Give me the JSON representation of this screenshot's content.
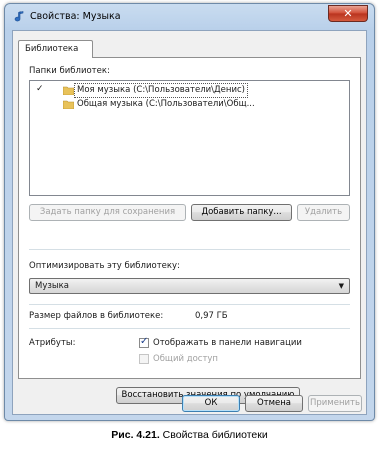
{
  "window": {
    "title": "Свойства: Музыка",
    "close_glyph": "✕"
  },
  "tab": {
    "label": "Библиотека"
  },
  "folders": {
    "label": "Папки библиотек:",
    "items": [
      {
        "check": "✓",
        "label": "Моя музыка (C:\\Пользователи\\Денис)"
      },
      {
        "check": "",
        "label": "Общая музыка (C:\\Пользователи\\Общ..."
      }
    ],
    "set_save_button": "Задать папку для сохранения",
    "add_button": "Добавить папку...",
    "remove_button": "Удалить"
  },
  "optimize": {
    "label": "Оптимизировать эту библиотеку:",
    "selected": "Музыка",
    "arrow": "▼"
  },
  "size": {
    "label": "Размер файлов в библиотеке:",
    "value": "0,97 ГБ"
  },
  "attributes": {
    "label": "Атрибуты:",
    "show_in_nav": {
      "checked": true,
      "mark": "✓",
      "label": "Отображать в панели навигации"
    },
    "shared": {
      "checked": false,
      "label": "Общий доступ"
    }
  },
  "restore_button": "Восстановить значения по умолчанию",
  "footer": {
    "ok": "ОК",
    "cancel": "Отмена",
    "apply": "Применить"
  },
  "caption": {
    "bold": "Рис. 4.21.",
    "text": " Свойства библиотеки"
  }
}
